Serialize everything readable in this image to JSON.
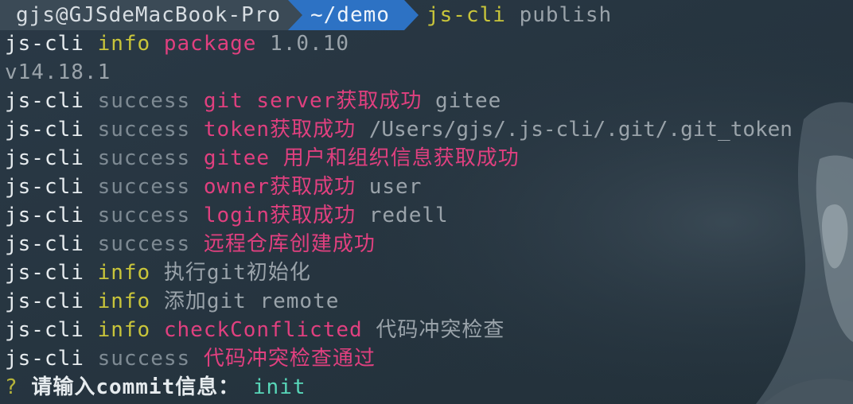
{
  "prompt": {
    "user_host": "gjs@GJSdeMacBook-Pro",
    "dir": "~/demo",
    "cmd_name": "js-cli",
    "cmd_arg": "publish"
  },
  "lines": [
    {
      "prefix": "js-cli",
      "level": "info",
      "msg": "package",
      "extra": "1.0.10"
    },
    {
      "plain": "v14.18.1"
    },
    {
      "prefix": "js-cli",
      "level": "success",
      "msg": "git server获取成功",
      "extra": "gitee"
    },
    {
      "prefix": "js-cli",
      "level": "success",
      "msg": "token获取成功",
      "extra": "/Users/gjs/.js-cli/.git/.git_token"
    },
    {
      "prefix": "js-cli",
      "level": "success",
      "msg": "gitee 用户和组织信息获取成功",
      "extra": ""
    },
    {
      "prefix": "js-cli",
      "level": "success",
      "msg": "owner获取成功",
      "extra": "user"
    },
    {
      "prefix": "js-cli",
      "level": "success",
      "msg": "login获取成功",
      "extra": "redell"
    },
    {
      "prefix": "js-cli",
      "level": "success",
      "msg": "远程仓库创建成功",
      "extra": ""
    },
    {
      "prefix": "js-cli",
      "level": "info",
      "msg": "执行git初始化",
      "extra": ""
    },
    {
      "prefix": "js-cli",
      "level": "info",
      "msg": "添加git remote",
      "extra": ""
    },
    {
      "prefix": "js-cli",
      "level": "info",
      "msg": "checkConflicted",
      "extra": "代码冲突检查"
    },
    {
      "prefix": "js-cli",
      "level": "success",
      "msg": "代码冲突检查通过",
      "extra": ""
    }
  ],
  "question": {
    "mark": "?",
    "label": "请输入commit信息：",
    "answer": "init"
  },
  "colors": {
    "background": "#263440",
    "prompt_user_bg": "#3b4a56",
    "prompt_dir_bg": "#2d72c4",
    "info": "#c9c53a",
    "success_label": "#7e8a93",
    "message": "#e0407f",
    "answer": "#58d7b9"
  }
}
